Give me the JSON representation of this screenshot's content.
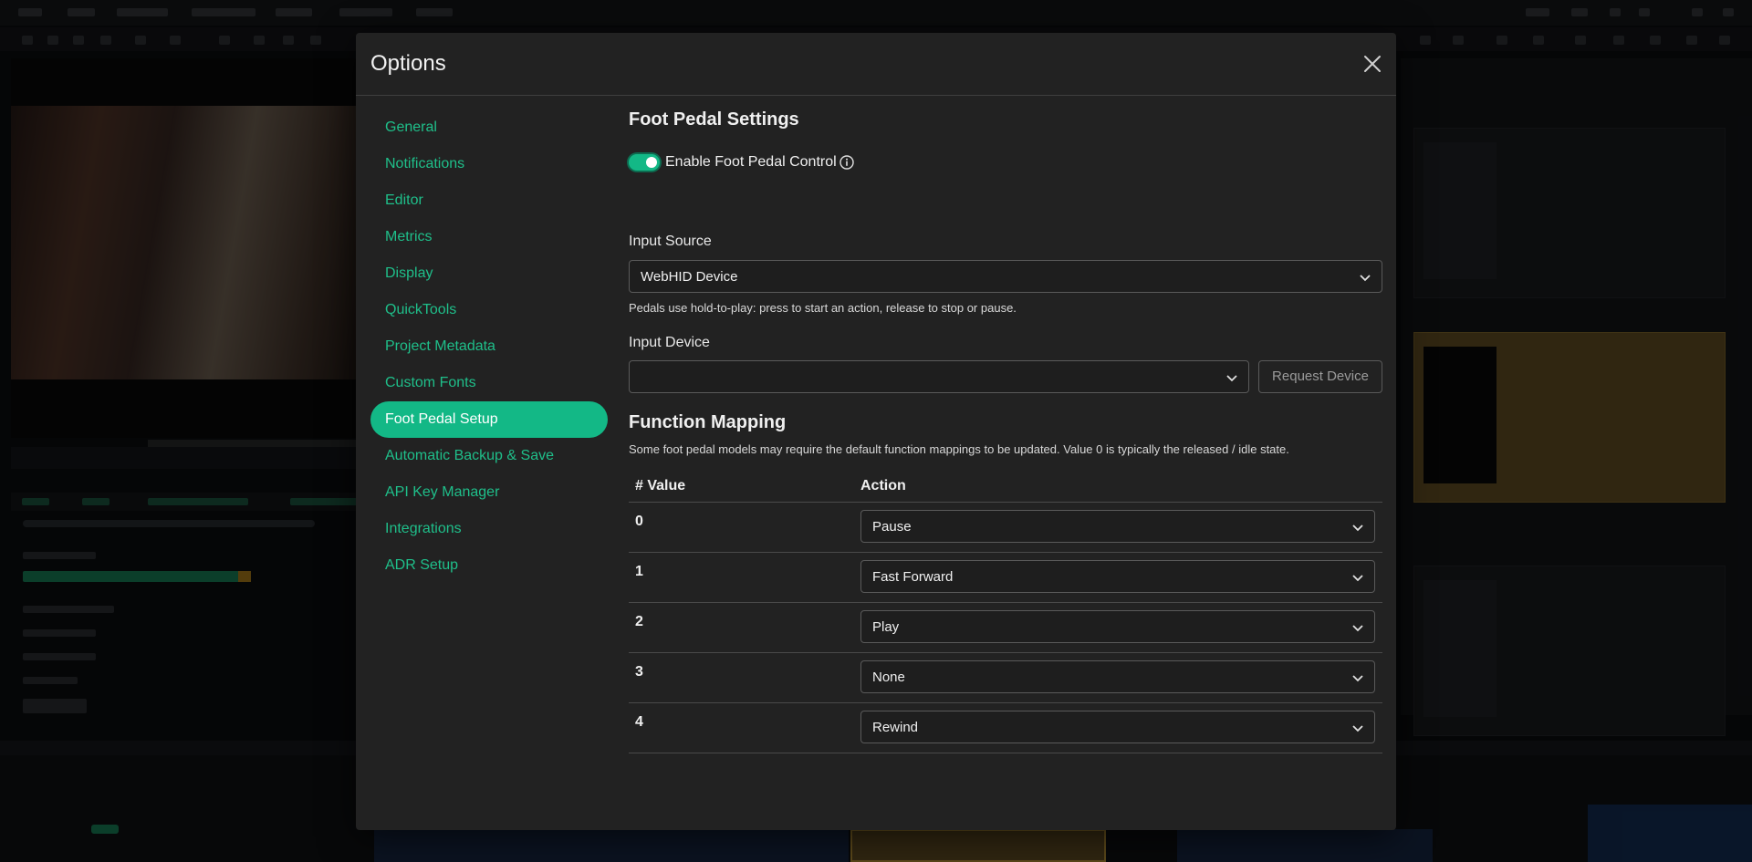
{
  "dialog": {
    "title": "Options",
    "close_icon": "close-icon"
  },
  "sidebar": {
    "items": [
      {
        "label": "General"
      },
      {
        "label": "Notifications"
      },
      {
        "label": "Editor"
      },
      {
        "label": "Metrics"
      },
      {
        "label": "Display"
      },
      {
        "label": "QuickTools"
      },
      {
        "label": "Project Metadata"
      },
      {
        "label": "Custom Fonts"
      },
      {
        "label": "Foot Pedal Setup",
        "active": true
      },
      {
        "label": "Automatic Backup & Save"
      },
      {
        "label": "API Key Manager"
      },
      {
        "label": "Integrations"
      },
      {
        "label": "ADR Setup"
      }
    ]
  },
  "foot_pedal": {
    "heading": "Foot Pedal Settings",
    "enable_label": "Enable Foot Pedal Control",
    "enabled": true,
    "input_source_label": "Input Source",
    "input_source_value": "WebHID Device",
    "input_source_hint": "Pedals use hold-to-play: press to start an action, release to stop or pause.",
    "input_device_label": "Input Device",
    "input_device_value": "",
    "request_device_label": "Request Device",
    "mapping_heading": "Function Mapping",
    "mapping_hint": "Some foot pedal models may require the default function mappings to be updated. Value 0 is typically the released / idle state.",
    "table": {
      "col_value": "# Value",
      "col_action": "Action",
      "rows": [
        {
          "value": "0",
          "action": "Pause"
        },
        {
          "value": "1",
          "action": "Fast Forward"
        },
        {
          "value": "2",
          "action": "Play"
        },
        {
          "value": "3",
          "action": "None"
        },
        {
          "value": "4",
          "action": "Rewind"
        }
      ]
    }
  },
  "colors": {
    "accent": "#13b886",
    "link": "#1fbf8a",
    "dialog_bg": "#222222"
  }
}
